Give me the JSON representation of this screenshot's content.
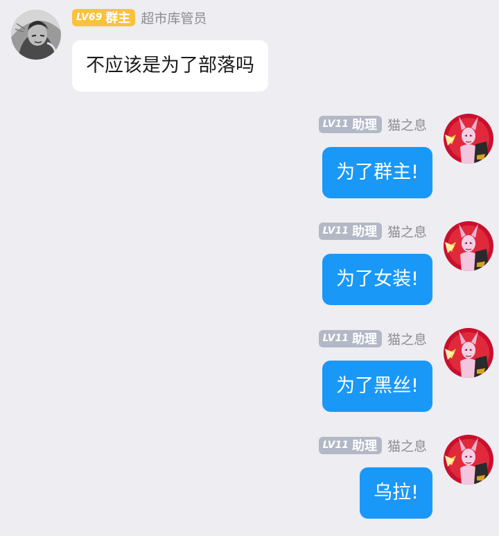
{
  "messages": [
    {
      "direction": "incoming",
      "avatar": "grayscale-sketch-avatar",
      "badge_level": "LV69",
      "badge_role": "群主",
      "badge_color": "#f9c23c",
      "sender": "超市库管员",
      "text": "不应该是为了部落吗"
    },
    {
      "direction": "outgoing",
      "avatar": "pink-armored-character-avatar",
      "badge_level": "LV11",
      "badge_role": "助理",
      "badge_color": "#b3b8c6",
      "sender": "猫之息",
      "text": "为了群主!"
    },
    {
      "direction": "outgoing",
      "avatar": "pink-armored-character-avatar",
      "badge_level": "LV11",
      "badge_role": "助理",
      "badge_color": "#b3b8c6",
      "sender": "猫之息",
      "text": "为了女装!"
    },
    {
      "direction": "outgoing",
      "avatar": "pink-armored-character-avatar",
      "badge_level": "LV11",
      "badge_role": "助理",
      "badge_color": "#b3b8c6",
      "sender": "猫之息",
      "text": "为了黑丝!"
    },
    {
      "direction": "outgoing",
      "avatar": "pink-armored-character-avatar",
      "badge_level": "LV11",
      "badge_role": "助理",
      "badge_color": "#b3b8c6",
      "sender": "猫之息",
      "text": "乌拉!"
    }
  ],
  "colors": {
    "background": "#ededf2",
    "incoming_bubble": "#ffffff",
    "outgoing_bubble": "#1a98f8",
    "sender_name": "#8c8c92"
  }
}
